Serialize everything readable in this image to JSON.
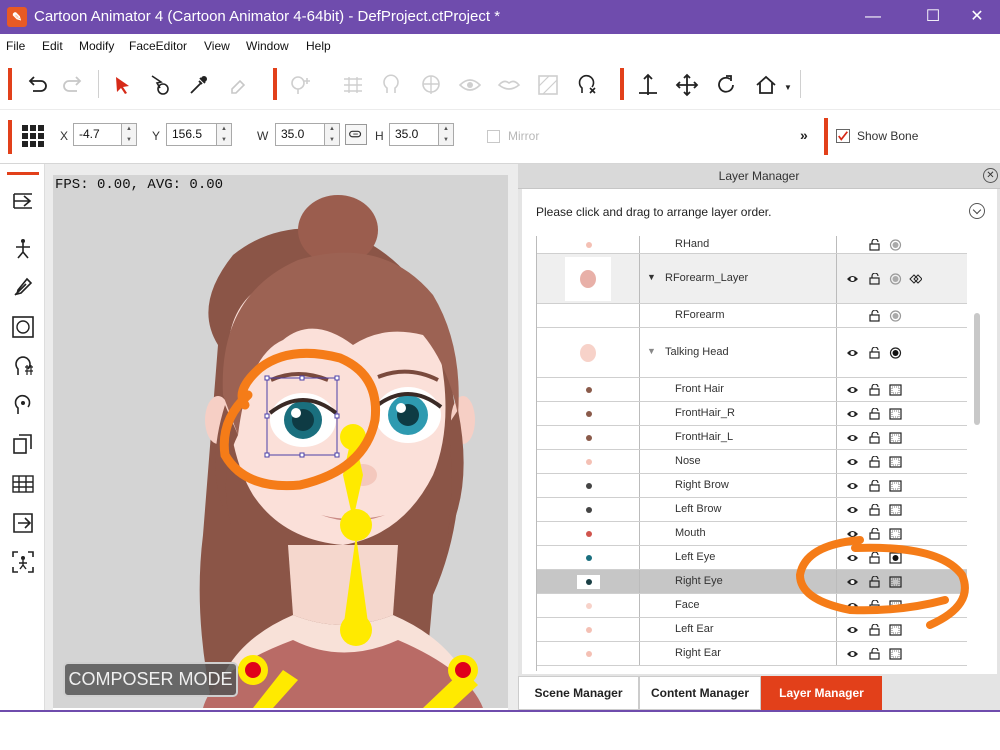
{
  "window": {
    "title": "Cartoon Animator 4  (Cartoon Animator 4-64bit) - DefProject.ctProject *",
    "minimize": "—",
    "maximize": "☐",
    "close": "✕",
    "accent": "#6f4cad"
  },
  "menu": [
    "File",
    "Edit",
    "Modify",
    "FaceEditor",
    "View",
    "Window",
    "Help"
  ],
  "toolbar1": {
    "icons": [
      "undo-icon",
      "redo-icon",
      "select-icon",
      "transform-icon",
      "pick-color-icon",
      "eraser-icon",
      "add-bone-icon",
      "sprite-grid-icon",
      "face-puppet-icon",
      "body-puppet-icon",
      "eye-icon",
      "lips-icon",
      "texture-icon",
      "face-key-icon",
      "move-vertical-icon",
      "move-all-icon",
      "rotate-icon",
      "home-icon"
    ]
  },
  "toolbar2": {
    "x_label": "X",
    "x_value": "-4.7",
    "y_label": "Y",
    "y_value": "156.5",
    "w_label": "W",
    "w_value": "35.0",
    "h_label": "H",
    "h_value": "35.0",
    "mirror_label": "Mirror",
    "more": "»",
    "show_bone_label": "Show Bone",
    "show_bone_checked": true
  },
  "viewport": {
    "fps_text": "FPS: 0.00, AVG: 0.00",
    "mode_badge": "COMPOSER MODE"
  },
  "layer_manager": {
    "title": "Layer Manager",
    "close": "✕",
    "instruction": "Please click and drag to arrange layer order.",
    "rows": [
      {
        "name": "RHand",
        "indent": 1,
        "eye": false,
        "mask": "dot-gray",
        "state": "normal"
      },
      {
        "name": "RForearm_Layer",
        "indent": 0,
        "caret": "▼",
        "eye": true,
        "mask": "dot-gray",
        "link": true,
        "state": "group"
      },
      {
        "name": "RForearm",
        "indent": 1,
        "eye": false,
        "mask": "dot-gray",
        "state": "normal"
      },
      {
        "name": "Talking Head",
        "indent": 0,
        "caret": "▼",
        "eye": true,
        "mask": "dot-black",
        "state": "normal"
      },
      {
        "name": "Front Hair",
        "indent": 1,
        "eye": true,
        "mask": "box",
        "state": "normal"
      },
      {
        "name": "FrontHair_R",
        "indent": 1,
        "eye": true,
        "mask": "box",
        "state": "normal"
      },
      {
        "name": "FrontHair_L",
        "indent": 1,
        "eye": true,
        "mask": "box",
        "state": "normal"
      },
      {
        "name": "Nose",
        "indent": 1,
        "eye": true,
        "mask": "box",
        "state": "normal"
      },
      {
        "name": "Right Brow",
        "indent": 1,
        "eye": true,
        "mask": "box",
        "state": "normal"
      },
      {
        "name": "Left Brow",
        "indent": 1,
        "eye": true,
        "mask": "box",
        "state": "normal"
      },
      {
        "name": "Mouth",
        "indent": 1,
        "eye": true,
        "mask": "box",
        "state": "normal"
      },
      {
        "name": "Left Eye",
        "indent": 1,
        "eye": true,
        "mask": "dot-black-box",
        "state": "normal"
      },
      {
        "name": "Right Eye",
        "indent": 1,
        "eye": true,
        "mask": "box",
        "state": "selected"
      },
      {
        "name": "Face",
        "indent": 1,
        "eye": true,
        "mask": "box",
        "state": "normal"
      },
      {
        "name": "Left Ear",
        "indent": 1,
        "eye": true,
        "mask": "box",
        "state": "normal"
      },
      {
        "name": "Right Ear",
        "indent": 1,
        "eye": true,
        "mask": "box",
        "state": "normal"
      }
    ]
  },
  "tabs": [
    {
      "label": "Scene Manager",
      "active": false
    },
    {
      "label": "Content Manager",
      "active": false
    },
    {
      "label": "Layer Manager",
      "active": true
    }
  ],
  "colors": {
    "accent_red": "#e2401a",
    "annotation_orange": "#f57c18",
    "bone_yellow": "#ffea00"
  }
}
